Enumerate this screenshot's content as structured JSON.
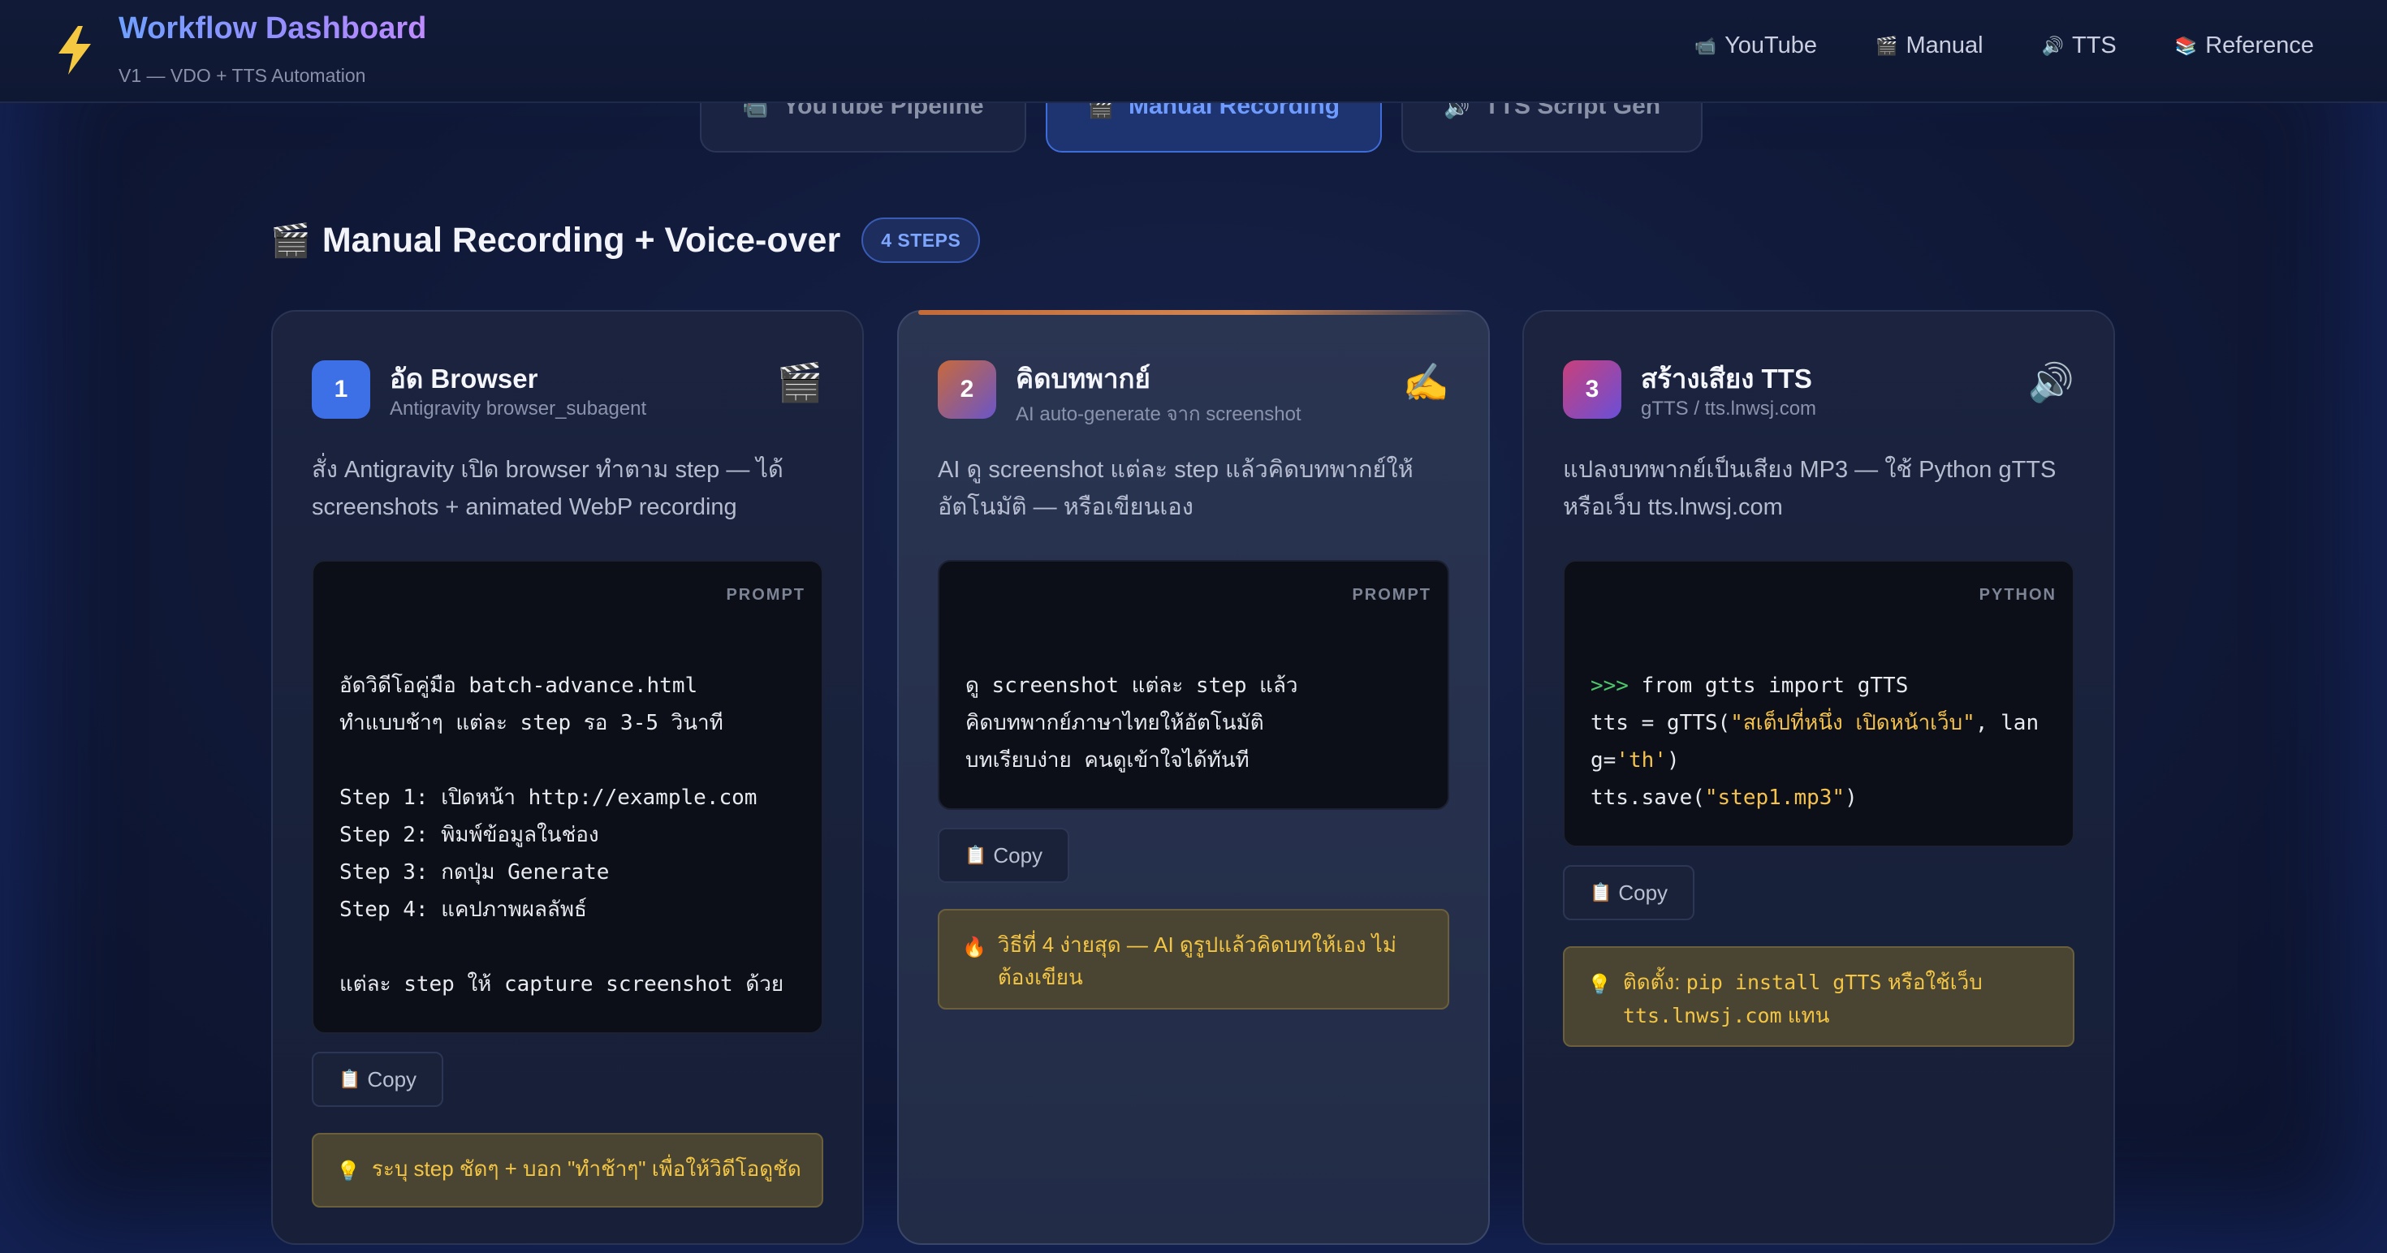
{
  "header": {
    "title": "Workflow Dashboard",
    "subtitle": "V1 — VDO + TTS Automation",
    "nav": [
      {
        "icon": "📹",
        "label": "YouTube"
      },
      {
        "icon": "🎬",
        "label": "Manual"
      },
      {
        "icon": "🔊",
        "label": "TTS"
      },
      {
        "icon": "📚",
        "label": "Reference"
      }
    ]
  },
  "tabs": [
    {
      "icon": "📹",
      "label": "YouTube Pipeline",
      "active": false
    },
    {
      "icon": "🎬",
      "label": "Manual Recording",
      "active": true
    },
    {
      "icon": "🔊",
      "label": "TTS Script Gen",
      "active": false
    }
  ],
  "section": {
    "icon": "🎬",
    "title": "Manual Recording + Voice-over",
    "badge": "4 STEPS"
  },
  "cards": [
    {
      "number": "1",
      "title": "อัด Browser",
      "subtitle": "Antigravity browser_subagent",
      "icon": "🎬",
      "description": "สั่ง Antigravity เปิด browser ทำตาม step — ได้ screenshots + animated WebP recording",
      "code_tag": "PROMPT",
      "code_lines": [
        "อัดวิดีโอคู่มือ batch-advance.html",
        "ทำแบบช้าๆ แต่ละ step รอ 3-5 วินาที",
        "",
        "Step 1: เปิดหน้า http://example.com",
        "Step 2: พิมพ์ข้อมูลในช่อง",
        "Step 3: กดปุ่ม Generate",
        "Step 4: แคปภาพผลลัพธ์",
        "",
        "แต่ละ step ให้ capture screenshot ด้วย"
      ],
      "copy_label": "Copy",
      "tip_icon": "💡",
      "tip": "ระบุ step ชัดๆ + บอก \"ทำช้าๆ\" เพื่อให้วิดีโอดูชัด"
    },
    {
      "number": "2",
      "title": "คิดบทพากย์",
      "subtitle": "AI auto-generate จาก screenshot",
      "icon": "✍️",
      "description": "AI ดู screenshot แต่ละ step แล้วคิดบทพากย์ให้อัตโนมัติ — หรือเขียนเอง",
      "code_tag": "PROMPT",
      "code_lines": [
        "ดู screenshot แต่ละ step แล้ว",
        "คิดบทพากย์ภาษาไทยให้อัตโนมัติ",
        "บทเรียบง่าย คนดูเข้าใจได้ทันที"
      ],
      "copy_label": "Copy",
      "tip_icon": "🔥",
      "tip": "วิธีที่ 4 ง่ายสุด — AI ดูรูปแล้วคิดบทให้เอง ไม่ต้องเขียน"
    },
    {
      "number": "3",
      "title": "สร้างเสียง TTS",
      "subtitle": "gTTS / tts.lnwsj.com",
      "icon": "🔊",
      "description": "แปลงบทพากย์เป็นเสียง MP3 — ใช้ Python gTTS หรือเว็บ tts.lnwsj.com",
      "code_tag": "PYTHON",
      "code": {
        "line1_prompt": ">>> ",
        "line1_rest": "from gtts import gTTS",
        "line2_a": "tts = gTTS(",
        "line2_str": "\"สเต็ปที่หนึ่ง เปิดหน้าเว็บ\"",
        "line2_b": ", lan",
        "line3_a": "g=",
        "line3_str": "'th'",
        "line3_b": ")",
        "line4_a": "tts.save(",
        "line4_str": "\"step1.mp3\"",
        "line4_b": ")"
      },
      "copy_label": "Copy",
      "tip_icon": "💡",
      "tip_prefix": "ติดตั้ง: ",
      "tip_code": "pip install gTTS",
      "tip_mid": " หรือใช้เว็บ ",
      "tip_code2": "tts.lnwsj.com",
      "tip_suffix": " แทน"
    }
  ],
  "colors": {
    "badge1": "#3d6fe6",
    "badge2_from": "#c8693c",
    "badge2_to": "#6a55c8",
    "badge3_from": "#c9407a",
    "badge3_to": "#6a4fd8",
    "accent": "#6f9bff",
    "tip_text": "#f2c544"
  }
}
